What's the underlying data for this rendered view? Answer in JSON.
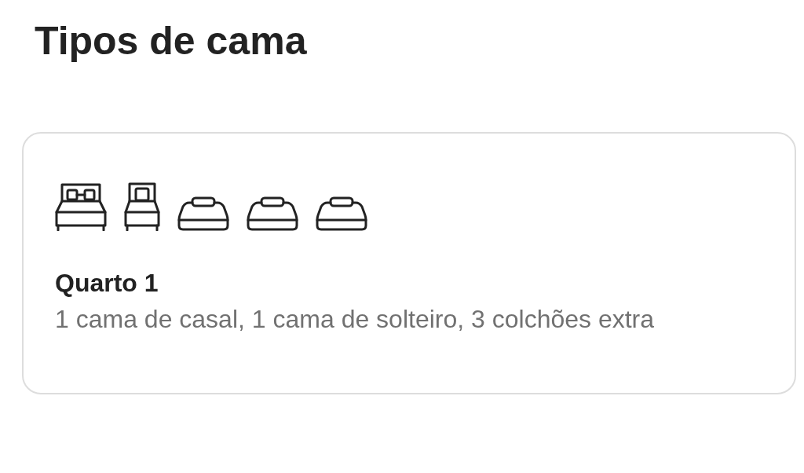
{
  "title": "Tipos de cama",
  "rooms": [
    {
      "beds": [
        {
          "kind": "double"
        },
        {
          "kind": "single"
        },
        {
          "kind": "mattress"
        },
        {
          "kind": "mattress"
        },
        {
          "kind": "mattress"
        }
      ],
      "name": "Quarto 1",
      "description": "1 cama de casal, 1 cama de solteiro, 3 colchões extra"
    }
  ]
}
